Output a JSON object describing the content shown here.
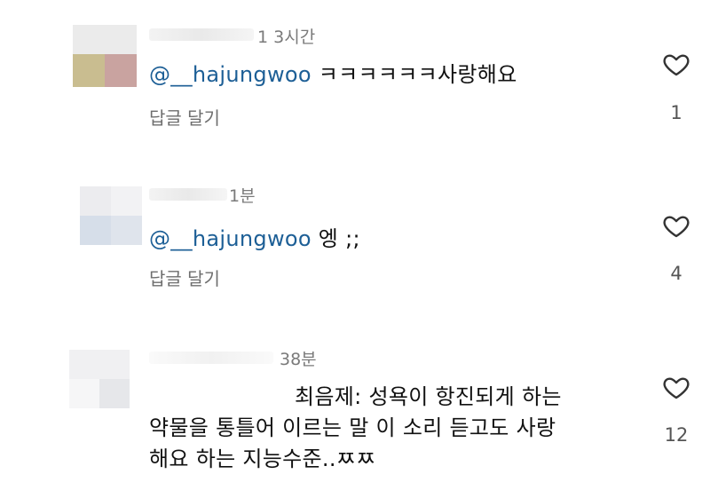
{
  "comments": [
    {
      "time": "1 3시간",
      "mention": "@__hajungwoo",
      "text": " ㅋㅋㅋㅋㅋㅋ사랑해요",
      "reply_label": "답글 달기",
      "likes": "1"
    },
    {
      "time": "1분",
      "mention": "@__hajungwoo",
      "text": " 엥 ;;",
      "reply_label": "답글 달기",
      "likes": "4"
    },
    {
      "time": "38분",
      "lines": [
        "최음제: 성욕이 항진되게 하는",
        "약물을 통틀어 이르는 말 이 소리 듣고도 사랑",
        "해요 하는 지능수준..ㅉㅉ"
      ],
      "likes": "12"
    }
  ],
  "icons": {
    "like": "heart-outline-icon"
  },
  "colors": {
    "mention": "#1d5f96",
    "meta": "#6e6e6e"
  }
}
